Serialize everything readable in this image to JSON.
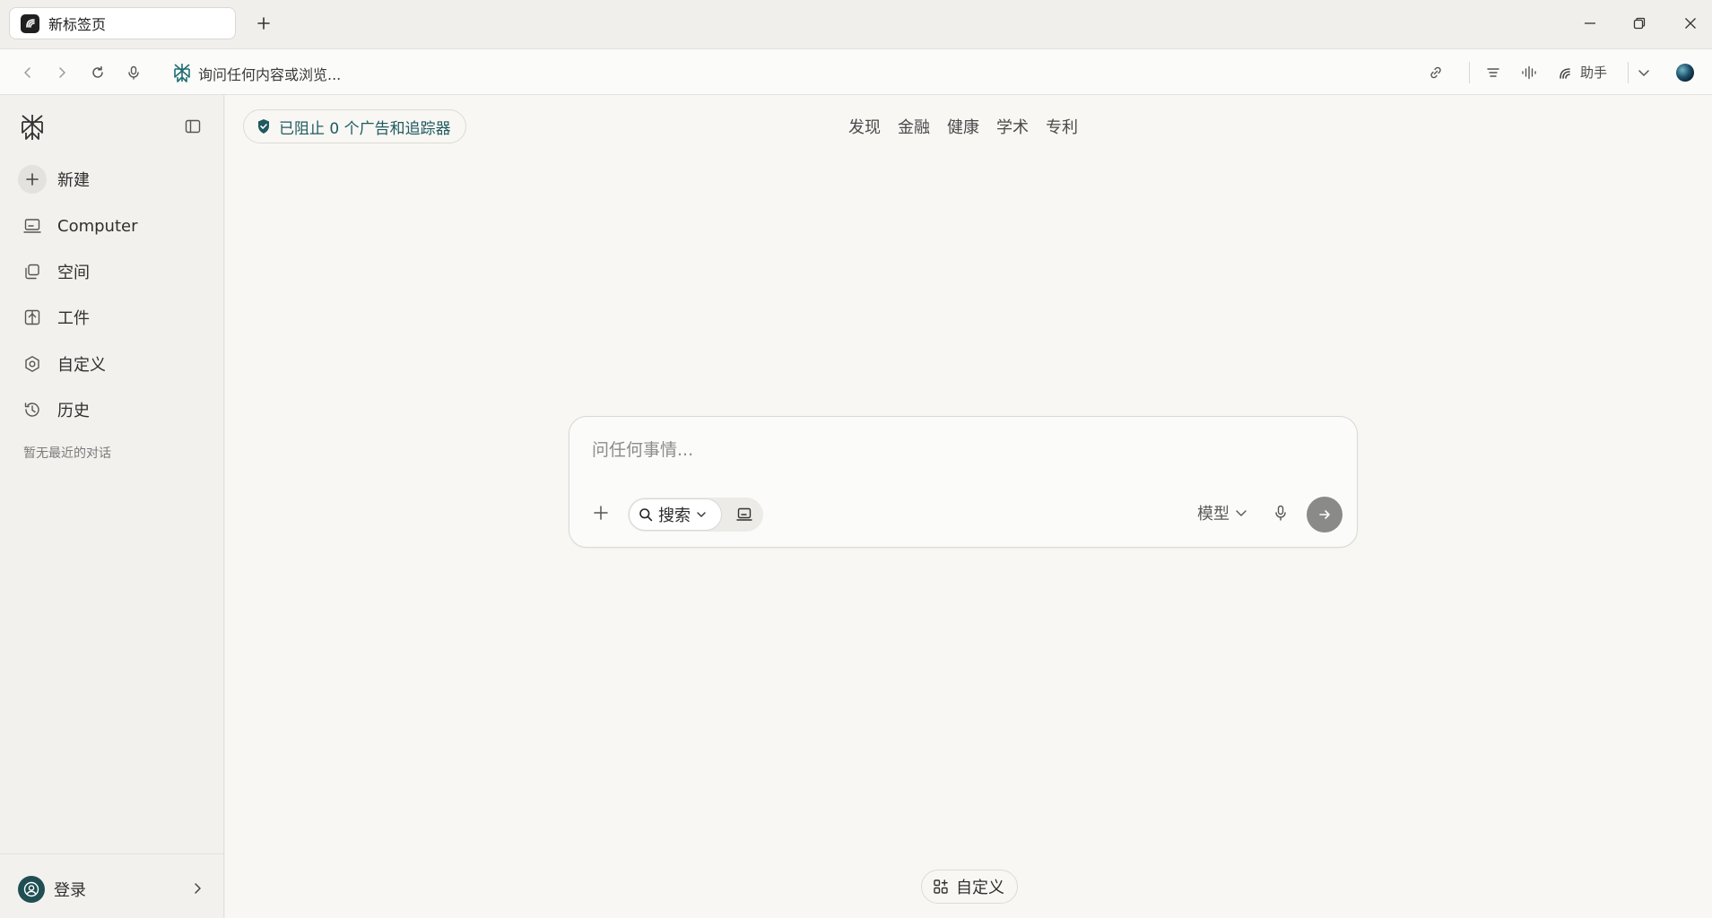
{
  "tab": {
    "title": "新标签页"
  },
  "omnibox": {
    "placeholder": "询问任何内容或浏览..."
  },
  "toolbar": {
    "assistant_label": "助手"
  },
  "sidebar": {
    "items": [
      {
        "label": "新建",
        "icon": "plus-icon"
      },
      {
        "label": "Computer",
        "icon": "computer-icon"
      },
      {
        "label": "空间",
        "icon": "spaces-icon"
      },
      {
        "label": "工件",
        "icon": "artifacts-icon"
      },
      {
        "label": "自定义",
        "icon": "hexagon-settings-icon"
      },
      {
        "label": "历史",
        "icon": "history-icon"
      }
    ],
    "empty_history": "暂无最近的对话",
    "login_label": "登录"
  },
  "main": {
    "blocked_badge": "已阻止 0 个广告和追踪器",
    "topnav": [
      "发现",
      "金融",
      "健康",
      "学术",
      "专利"
    ],
    "composer": {
      "placeholder": "问任何事情...",
      "search_label": "搜索",
      "model_label": "模型"
    },
    "customize_label": "自定义"
  },
  "colors": {
    "accent": "#1f5a60",
    "send_button": "#8a8a88",
    "background": "#f8f7f4",
    "sidebar": "#f2f1ee"
  }
}
